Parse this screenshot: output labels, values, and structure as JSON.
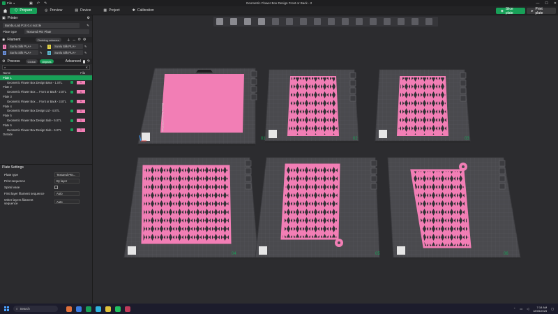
{
  "window": {
    "title": "Geometric Flower Box Design Front or Back - 2",
    "menu_label": "File"
  },
  "tabs": [
    {
      "label": "Prepare"
    },
    {
      "label": "Preview"
    },
    {
      "label": "Device"
    },
    {
      "label": "Project"
    },
    {
      "label": "Calibration"
    }
  ],
  "actions": {
    "slice_label": "Slice plate",
    "print_label": "Print plate"
  },
  "printer": {
    "section_label": "Printer",
    "printer_name": "Bambu Lab P1S 0.4 nozzle",
    "plate_type_label": "Plate type",
    "plate_type_value": "Textured PEI Plate"
  },
  "filament": {
    "section_label": "Filament",
    "flushing_label": "Flushing volumes",
    "items": [
      {
        "num": "1",
        "name": "Sunlu Silk PLA+",
        "color": "#f27eb5"
      },
      {
        "num": "3",
        "name": "Sunlu Silk PLA+",
        "color": "#e8d84a"
      },
      {
        "num": "2",
        "name": "Sunlu Silk PLA+",
        "color": "#6a8fd8"
      },
      {
        "num": "4",
        "name": "Sunlu Silk PLA+",
        "color": "#5fb8d0"
      }
    ]
  },
  "process": {
    "section_label": "Process",
    "global_label": "Global",
    "objects_label": "Objects",
    "advanced_label": "Advanced",
    "col_name": "Name",
    "col_fila": "Fila",
    "rows": [
      {
        "kind": "plate",
        "name": "Plate 1"
      },
      {
        "kind": "part",
        "name": "Geometric Flower Box Design Base - 1.STL",
        "fila": "1"
      },
      {
        "kind": "plate",
        "name": "Plate 2"
      },
      {
        "kind": "part",
        "name": "Geometric Flower Box ... Front or Back - 2.STL",
        "fila": "1"
      },
      {
        "kind": "plate",
        "name": "Plate 3"
      },
      {
        "kind": "part",
        "name": "Geometric Flower Box ... Front or Back - 3.STL",
        "fila": "1"
      },
      {
        "kind": "plate",
        "name": "Plate 4"
      },
      {
        "kind": "part",
        "name": "Geometric Flower Box Design Lid - 4.STL",
        "fila": "1"
      },
      {
        "kind": "plate",
        "name": "Plate 5"
      },
      {
        "kind": "part",
        "name": "Geometric Flower Box Design Side - 5.STL",
        "fila": "1"
      },
      {
        "kind": "plate",
        "name": "Plate 6"
      },
      {
        "kind": "part",
        "name": "Geometric Flower Box Design Side - 6.STL",
        "fila": "1"
      },
      {
        "kind": "plate",
        "name": "Outside"
      }
    ]
  },
  "plate_settings": {
    "section_label": "Plate Settings",
    "rows": [
      {
        "label": "Plate type",
        "value": "Textured PEI..."
      },
      {
        "label": "Print sequence",
        "value": "By layer"
      },
      {
        "label": "Spiral vase",
        "value": ""
      },
      {
        "label": "First layer filament sequence",
        "value": "Auto"
      },
      {
        "label": "Other layers filament sequence",
        "value": "Auto"
      }
    ]
  },
  "plates": [
    {
      "num": "01",
      "object": "base"
    },
    {
      "num": "02",
      "object": "panel"
    },
    {
      "num": "03",
      "object": "panel"
    },
    {
      "num": "04",
      "object": "lid"
    },
    {
      "num": "05",
      "object": "side"
    },
    {
      "num": "06",
      "object": "side"
    }
  ],
  "bed_label": "Bambu Textured PEI Plate",
  "taskbar": {
    "search_placeholder": "Search",
    "time": "7:18 AM",
    "date": "18/05/2025"
  },
  "colors": {
    "accent": "#18a058",
    "filament_pink": "#f27eb5",
    "bed": "#4a4a4e"
  }
}
